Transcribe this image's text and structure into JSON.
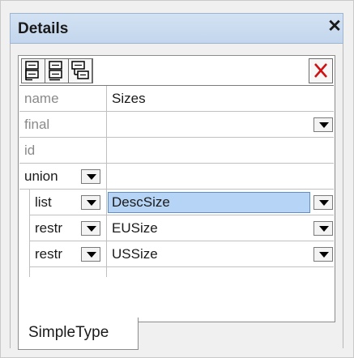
{
  "window": {
    "title": "Details"
  },
  "toolbar": {
    "buttons": [
      {
        "icon": "add-before-icon"
      },
      {
        "icon": "add-after-icon"
      },
      {
        "icon": "add-child-icon"
      }
    ],
    "delete_icon": "delete-x-icon",
    "delete_color": "#d01010"
  },
  "properties": [
    {
      "label": "name",
      "value": "Sizes",
      "dropdown": false,
      "label_style": "gray"
    },
    {
      "label": "final",
      "value": "",
      "dropdown": true,
      "label_style": "gray"
    },
    {
      "label": "id",
      "value": "",
      "dropdown": false,
      "label_style": "gray"
    }
  ],
  "union_row": {
    "label": "union",
    "value": ""
  },
  "members": [
    {
      "kind": "list",
      "value": "DescSize",
      "selected": true
    },
    {
      "kind": "restr",
      "value": "EUSize",
      "selected": false
    },
    {
      "kind": "restr",
      "value": "USSize",
      "selected": false
    }
  ],
  "tabs": [
    {
      "label": "SimpleType",
      "active": true
    }
  ],
  "colors": {
    "titlebar": "#c8dbf0",
    "selection": "#b6d4f5"
  }
}
